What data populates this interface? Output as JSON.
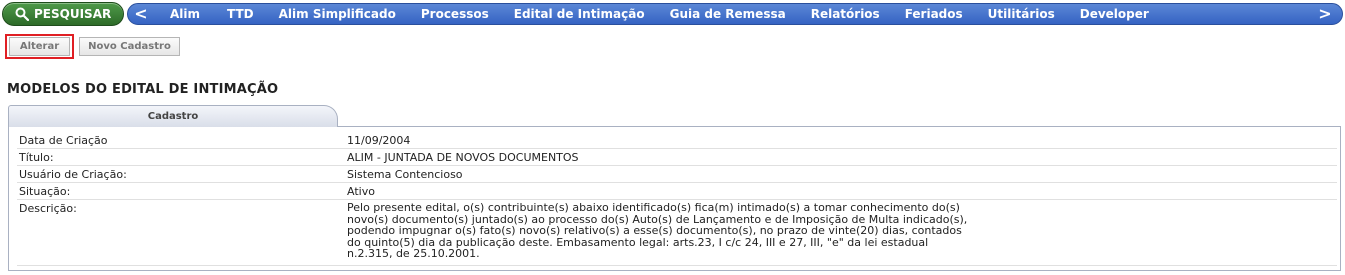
{
  "toolbar": {
    "search_label": "PESQUISAR",
    "search_icon": "magnifier-icon",
    "nav_prev": "<",
    "nav_next": ">",
    "menu": [
      "Alim",
      "TTD",
      "Alim Simplificado",
      "Processos",
      "Edital de Intimação",
      "Guia de Remessa",
      "Relatórios",
      "Feriados",
      "Utilitários",
      "Developer"
    ]
  },
  "actions": {
    "alterar": "Alterar",
    "novo": "Novo Cadastro"
  },
  "page_title": "MODELOS DO EDITAL DE INTIMAÇÃO",
  "tab_label": "Cadastro",
  "fields": [
    {
      "label": "Data de Criação",
      "value": "11/09/2004"
    },
    {
      "label": "Título:",
      "value": "ALIM - JUNTADA DE NOVOS DOCUMENTOS"
    },
    {
      "label": "Usuário de Criação:",
      "value": "Sistema Contencioso"
    },
    {
      "label": "Situação:",
      "value": "Ativo"
    }
  ],
  "description": {
    "label": "Descrição:",
    "lines": [
      "Pelo presente edital, o(s) contribuinte(s) abaixo identificado(s) fica(m) intimado(s) a tomar conhecimento do(s)",
      "novo(s) documento(s) juntado(s) ao processo do(s) Auto(s) de Lançamento e de Imposição de Multa indicado(s),",
      "podendo impugnar o(s) fato(s) novo(s) relativo(s) a esse(s) documento(s), no prazo de vinte(20) dias, contados",
      "do quinto(5) dia da publicação deste. Embasamento legal: arts.23, I c/c 24, III e 27, III, \"e\" da lei estadual",
      "n.2.315, de 25.10.2001."
    ]
  },
  "colors": {
    "search_green": "#2d6b28",
    "nav_blue": "#3563c3",
    "highlight_red": "#e01f24"
  }
}
